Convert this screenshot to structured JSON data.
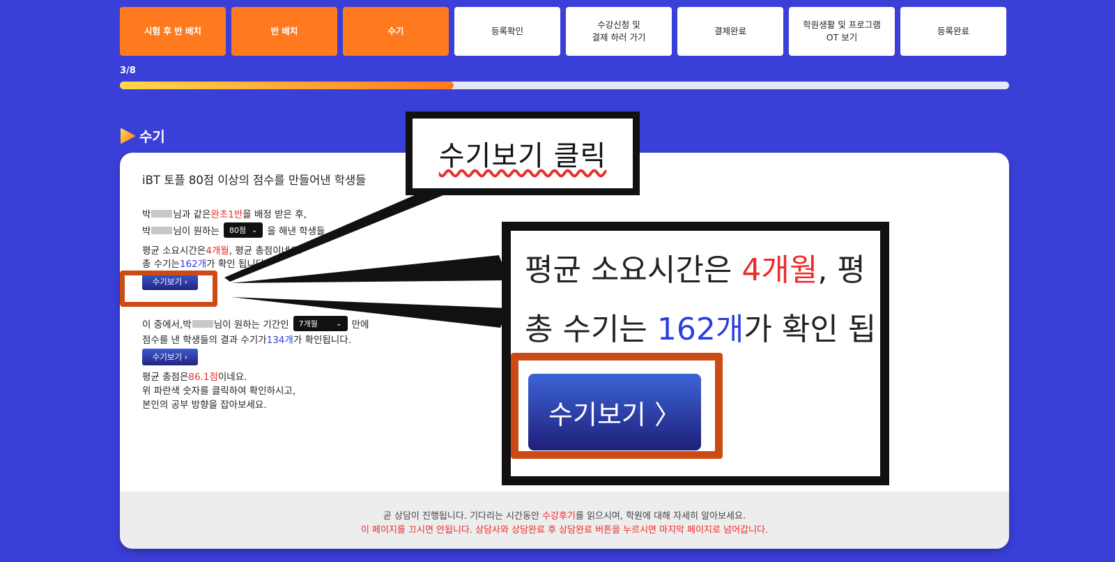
{
  "steps": [
    {
      "label": "시험 후 반 배치",
      "done": true
    },
    {
      "label": "반 배치",
      "done": true
    },
    {
      "label": "수기",
      "done": true
    },
    {
      "label": "등록확인",
      "done": false
    },
    {
      "label": "수강신청 및\n결제 하러 가기",
      "done": false
    },
    {
      "label": "결제완료",
      "done": false
    },
    {
      "label": "학원생활 및 프로그램\nOT 보기",
      "done": false
    },
    {
      "label": "등록완료",
      "done": false
    }
  ],
  "progress": {
    "label": "3/8",
    "fraction": 0.375
  },
  "section": {
    "title": "수기"
  },
  "card": {
    "heading": "iBT 토플 80점 이상의 점수를 만들어낸 학생들",
    "line1": {
      "a": "박",
      "b": "님과 같은 ",
      "c": "완초1반",
      "d": "을 배정 받은 후,"
    },
    "line2": {
      "a": "박",
      "b": "님이 원하는 ",
      "select": "80점",
      "c": "을 해낸 학생들"
    },
    "line3": {
      "a": "평균 소요시간은 ",
      "b": "4개월",
      "c": ", 평균 총점",
      "d": "이네요."
    },
    "line4": {
      "a": "총 수기는 ",
      "b": "162개",
      "c": "가 확인 됩니다."
    },
    "view_button": "수기보기 ›",
    "line5": {
      "a": "이 중에서,박",
      "b": "님이 원하는 기간인",
      "select": "7개월",
      "c": "만에"
    },
    "line6": {
      "a": "점수를 낸 학생들의 결과 수기가 ",
      "b": "134개",
      "c": "가 확인됩니다."
    },
    "line7": {
      "a": "평균 총점은 ",
      "b": "86.1점",
      "c": "이네요."
    },
    "line8": "위 파란색 숫자를 클릭하여 확인하시고,",
    "line9": "본인의 공부 방향을 잡아보세요."
  },
  "footer": {
    "line1_a": "곧 상담이 진행됩니다. 기다리는 시간동안 ",
    "line1_link": "수강후기",
    "line1_b": "를 읽으시며, 학원에 대해 자세히 알아보세요.",
    "line2": "이 페이지를 끄시면 안됩니다. 상담사와 상담완료 후 상담완료 버튼을 누르시면 마지막 페이지로 넘어갑니다."
  },
  "annotation": {
    "callout_text": "수기보기 클릭",
    "zoom_line1_a": "평균 소요시간은 ",
    "zoom_line1_b": "4개월",
    "zoom_line1_c": ", 평",
    "zoom_line2_a": "총 수기는 ",
    "zoom_line2_b": "162개",
    "zoom_line2_c": "가 확인 됩",
    "zoom_button": "수기보기 〉"
  },
  "colors": {
    "background": "#3a3fd8",
    "step_done": "#ff7a1f",
    "highlight": "#cc4a14",
    "red_text": "#ee2a2a",
    "blue_text": "#2a3de0"
  }
}
